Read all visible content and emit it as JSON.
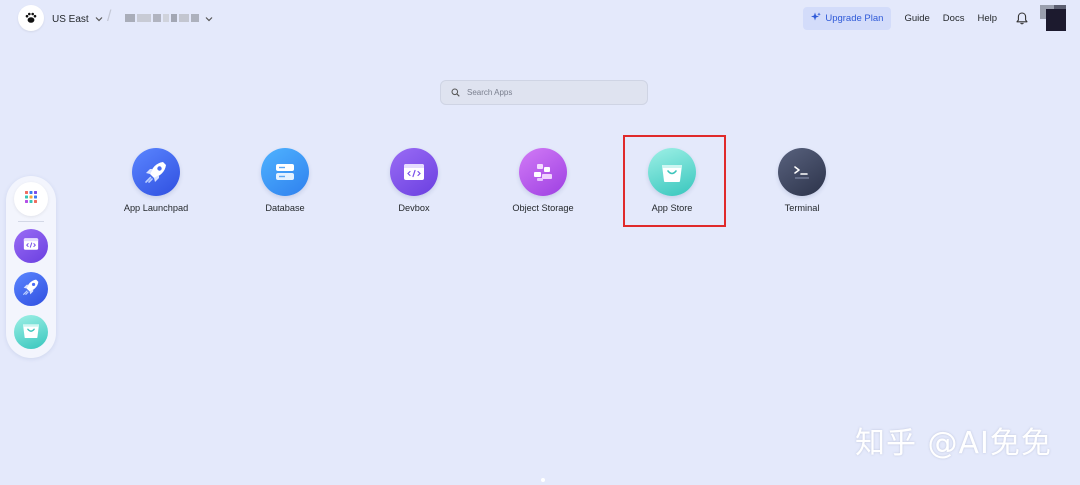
{
  "header": {
    "region_label": "US East",
    "separator": "/",
    "nav": {
      "upgrade_label": "Upgrade Plan",
      "guide_label": "Guide",
      "docs_label": "Docs",
      "help_label": "Help"
    },
    "icons": {
      "logo": "paw-logo-icon",
      "region_chevron": "chevron-down-icon",
      "workspace_chevron": "chevron-down-icon",
      "upgrade": "sparkle-icon",
      "bell": "bell-icon"
    }
  },
  "search": {
    "placeholder": "Search Apps",
    "icon": "search-icon"
  },
  "apps": [
    {
      "label": "App Launchpad",
      "icon": "rocket-icon",
      "color": "#3b63f0"
    },
    {
      "label": "Database",
      "icon": "database-icon",
      "color": "#2f8ff2"
    },
    {
      "label": "Devbox",
      "icon": "code-window-icon",
      "color": "#7a4de8"
    },
    {
      "label": "Object Storage",
      "icon": "storage-blocks-icon",
      "color": "#b44fe6"
    },
    {
      "label": "App Store",
      "icon": "shopping-bag-icon",
      "color": "#34c9c0",
      "highlighted": true
    },
    {
      "label": "Terminal",
      "icon": "terminal-icon",
      "color": "#3c4560"
    }
  ],
  "dock": [
    {
      "icon": "app-grid-icon",
      "color": "#ffffff"
    },
    {
      "icon": "code-window-icon",
      "color": "#7a4de8"
    },
    {
      "icon": "rocket-icon",
      "color": "#3b63f0"
    },
    {
      "icon": "shopping-bag-icon",
      "color": "#34c9c0"
    }
  ],
  "watermark": "知乎 @AI免免",
  "colors": {
    "background": "#e4e9fb",
    "accent": "#2f5ad8",
    "highlight_border": "#e02a2a"
  }
}
